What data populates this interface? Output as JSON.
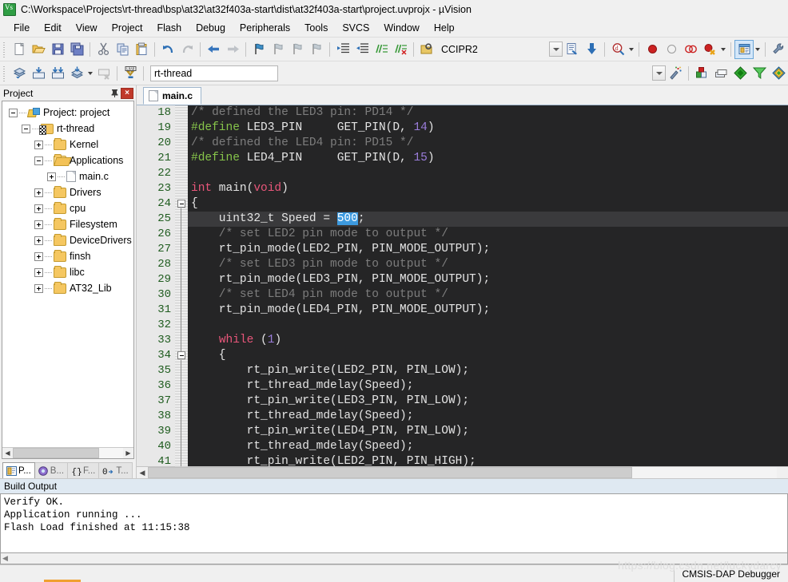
{
  "window": {
    "title": "C:\\Workspace\\Projects\\rt-thread\\bsp\\at32\\at32f403a-start\\dist\\at32f403a-start\\project.uvprojx - µVision",
    "app_icon": "uvision-icon"
  },
  "menubar": {
    "items": [
      "File",
      "Edit",
      "View",
      "Project",
      "Flash",
      "Debug",
      "Peripherals",
      "Tools",
      "SVCS",
      "Window",
      "Help"
    ]
  },
  "toolbar_main": {
    "target_label": "CCIPR2",
    "icons": [
      "new-file-icon",
      "open-file-icon",
      "save-icon",
      "save-all-icon",
      "cut-icon",
      "copy-icon",
      "paste-icon",
      "undo-icon",
      "redo-icon",
      "navigate-back-icon",
      "navigate-forward-icon",
      "bookmark-toggle-icon",
      "bookmark-prev-icon",
      "bookmark-next-icon",
      "bookmark-clear-icon",
      "indent-right-icon",
      "indent-left-icon",
      "comment-icon",
      "uncomment-icon",
      "configure-target-icon",
      "dropdown-icon",
      "text-properties-icon",
      "debug-settings-icon",
      "insert-breakpoint-icon",
      "disable-breakpoint-icon",
      "disable-all-breakpoints-icon",
      "kill-all-breakpoints-icon",
      "manage-windows-icon",
      "configure-icon"
    ]
  },
  "toolbar_build": {
    "target_value": "rt-thread",
    "icons": [
      "translate-icon",
      "build-icon",
      "rebuild-icon",
      "batch-build-icon",
      "stop-build-icon",
      "download-icon",
      "dropdown-icon",
      "manage-project-items-icon",
      "manage-components-icon",
      "manage-layers-icon",
      "pack-installer-icon",
      "svcs-icon",
      "book-icon"
    ]
  },
  "project_pane": {
    "title": "Project",
    "pin_glyph": "■",
    "close_glyph": "×",
    "tree": [
      {
        "label": "Project: project",
        "depth": 0,
        "icon": "project-icon",
        "expander": "minus"
      },
      {
        "label": "rt-thread",
        "depth": 1,
        "icon": "target-icon",
        "expander": "minus"
      },
      {
        "label": "Kernel",
        "depth": 2,
        "icon": "folder-icon",
        "expander": "plus"
      },
      {
        "label": "Applications",
        "depth": 2,
        "icon": "folder-open-icon",
        "expander": "minus"
      },
      {
        "label": "main.c",
        "depth": 3,
        "icon": "file-icon",
        "expander": "plus"
      },
      {
        "label": "Drivers",
        "depth": 2,
        "icon": "folder-icon",
        "expander": "plus"
      },
      {
        "label": "cpu",
        "depth": 2,
        "icon": "folder-icon",
        "expander": "plus"
      },
      {
        "label": "Filesystem",
        "depth": 2,
        "icon": "folder-icon",
        "expander": "plus"
      },
      {
        "label": "DeviceDrivers",
        "depth": 2,
        "icon": "folder-icon",
        "expander": "plus"
      },
      {
        "label": "finsh",
        "depth": 2,
        "icon": "folder-icon",
        "expander": "plus"
      },
      {
        "label": "libc",
        "depth": 2,
        "icon": "folder-icon",
        "expander": "plus"
      },
      {
        "label": "AT32_Lib",
        "depth": 2,
        "icon": "folder-icon",
        "expander": "plus"
      }
    ],
    "tabs": [
      {
        "label": "P...",
        "icon": "project-tab-icon",
        "selected": true
      },
      {
        "label": "B...",
        "icon": "books-tab-icon",
        "selected": false
      },
      {
        "label": "F...",
        "icon": "functions-tab-icon",
        "selected": false
      },
      {
        "label": "T...",
        "icon": "templates-tab-icon",
        "selected": false
      }
    ]
  },
  "editor": {
    "tab_label": "main.c",
    "tab_icon": "c-file-icon",
    "first_line_number": 18,
    "lines": [
      {
        "n": 18,
        "tokens": [
          {
            "t": "/* defined the LED3 pin: PD14 */",
            "c": "cmt"
          }
        ]
      },
      {
        "n": 19,
        "tokens": [
          {
            "t": "#define",
            "c": "pp"
          },
          {
            "t": " LED3_PIN     GET_PIN(D, ",
            "c": ""
          },
          {
            "t": "14",
            "c": "num"
          },
          {
            "t": ")",
            "c": ""
          }
        ]
      },
      {
        "n": 20,
        "tokens": [
          {
            "t": "/* defined the LED4 pin: PD15 */",
            "c": "cmt"
          }
        ]
      },
      {
        "n": 21,
        "tokens": [
          {
            "t": "#define",
            "c": "pp"
          },
          {
            "t": " LED4_PIN     GET_PIN(D, ",
            "c": ""
          },
          {
            "t": "15",
            "c": "num"
          },
          {
            "t": ")",
            "c": ""
          }
        ]
      },
      {
        "n": 22,
        "tokens": []
      },
      {
        "n": 23,
        "tokens": [
          {
            "t": "int",
            "c": "kw"
          },
          {
            "t": " main(",
            "c": ""
          },
          {
            "t": "void",
            "c": "kw"
          },
          {
            "t": ")",
            "c": ""
          }
        ]
      },
      {
        "n": 24,
        "tokens": [
          {
            "t": "{",
            "c": ""
          }
        ]
      },
      {
        "n": 25,
        "current": true,
        "tokens": [
          {
            "t": "    uint32_t Speed = ",
            "c": ""
          },
          {
            "t": "500",
            "c": "sel"
          },
          {
            "t": ";",
            "c": ""
          }
        ]
      },
      {
        "n": 26,
        "tokens": [
          {
            "t": "    /* set LED2 pin mode to output */",
            "c": "cmt"
          }
        ]
      },
      {
        "n": 27,
        "tokens": [
          {
            "t": "    rt_pin_mode(LED2_PIN, PIN_MODE_OUTPUT);",
            "c": ""
          }
        ]
      },
      {
        "n": 28,
        "tokens": [
          {
            "t": "    /* set LED3 pin mode to output */",
            "c": "cmt"
          }
        ]
      },
      {
        "n": 29,
        "tokens": [
          {
            "t": "    rt_pin_mode(LED3_PIN, PIN_MODE_OUTPUT);",
            "c": ""
          }
        ]
      },
      {
        "n": 30,
        "tokens": [
          {
            "t": "    /* set LED4 pin mode to output */",
            "c": "cmt"
          }
        ]
      },
      {
        "n": 31,
        "tokens": [
          {
            "t": "    rt_pin_mode(LED4_PIN, PIN_MODE_OUTPUT);",
            "c": ""
          }
        ]
      },
      {
        "n": 32,
        "tokens": []
      },
      {
        "n": 33,
        "tokens": [
          {
            "t": "    ",
            "c": ""
          },
          {
            "t": "while",
            "c": "kw"
          },
          {
            "t": " (",
            "c": ""
          },
          {
            "t": "1",
            "c": "num"
          },
          {
            "t": ")",
            "c": ""
          }
        ]
      },
      {
        "n": 34,
        "tokens": [
          {
            "t": "    {",
            "c": ""
          }
        ]
      },
      {
        "n": 35,
        "tokens": [
          {
            "t": "        rt_pin_write(LED2_PIN, PIN_LOW);",
            "c": ""
          }
        ]
      },
      {
        "n": 36,
        "tokens": [
          {
            "t": "        rt_thread_mdelay(Speed);",
            "c": ""
          }
        ]
      },
      {
        "n": 37,
        "tokens": [
          {
            "t": "        rt_pin_write(LED3_PIN, PIN_LOW);",
            "c": ""
          }
        ]
      },
      {
        "n": 38,
        "tokens": [
          {
            "t": "        rt_thread_mdelay(Speed);",
            "c": ""
          }
        ]
      },
      {
        "n": 39,
        "tokens": [
          {
            "t": "        rt_pin_write(LED4_PIN, PIN_LOW);",
            "c": ""
          }
        ]
      },
      {
        "n": 40,
        "tokens": [
          {
            "t": "        rt_thread_mdelay(Speed);",
            "c": ""
          }
        ]
      },
      {
        "n": 41,
        "tokens": [
          {
            "t": "        rt_pin_write(LED2_PIN, PIN_HIGH);",
            "c": ""
          }
        ]
      }
    ],
    "colors": {
      "background": "#252526",
      "text": "#e4e4e4",
      "comment": "#7d7d7d",
      "preprocessor": "#86c44a",
      "keyword": "#e8567a",
      "number": "#9b7ddb",
      "selection": "#3d9adf",
      "current_line": "#3a3a3c",
      "gutter_background": "#e8e8e8",
      "gutter_text": "#1f5c1f"
    }
  },
  "build_output": {
    "title": "Build Output",
    "lines": [
      "Verify OK.",
      "Application running ...",
      "Flash Load finished at 11:15:38"
    ]
  },
  "statusbar": {
    "debugger": "CMSIS-DAP Debugger",
    "watermark": "https://blog.csdn.net/luckydarcy"
  }
}
